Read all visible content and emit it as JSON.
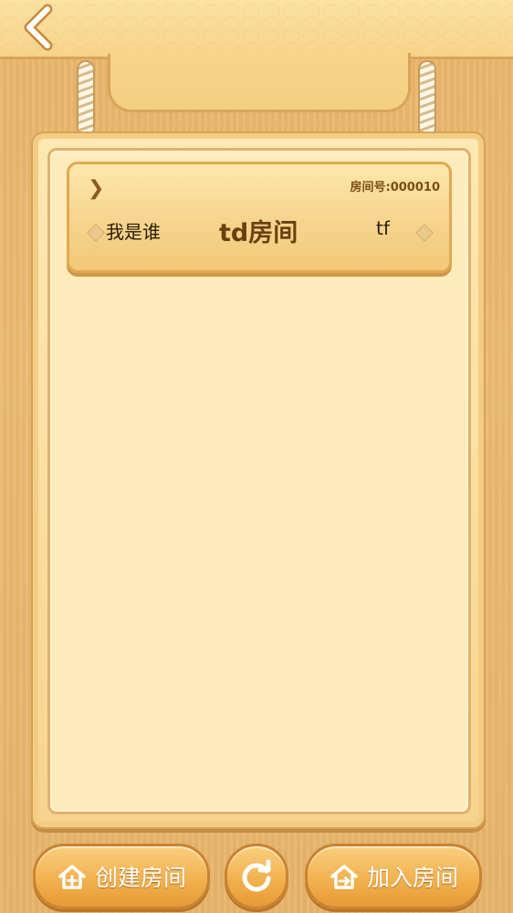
{
  "header": {
    "back_icon": "chevron-left-icon"
  },
  "room_list": {
    "rooms": [
      {
        "room_number_label": "房间号:000010",
        "owner_name": "我是谁",
        "room_name": "td房间",
        "tag": "tf"
      }
    ]
  },
  "footer": {
    "create_label": "创建房间",
    "create_icon": "home-plus-icon",
    "refresh_icon": "refresh-icon",
    "join_label": "加入房间",
    "join_icon": "home-enter-icon"
  }
}
